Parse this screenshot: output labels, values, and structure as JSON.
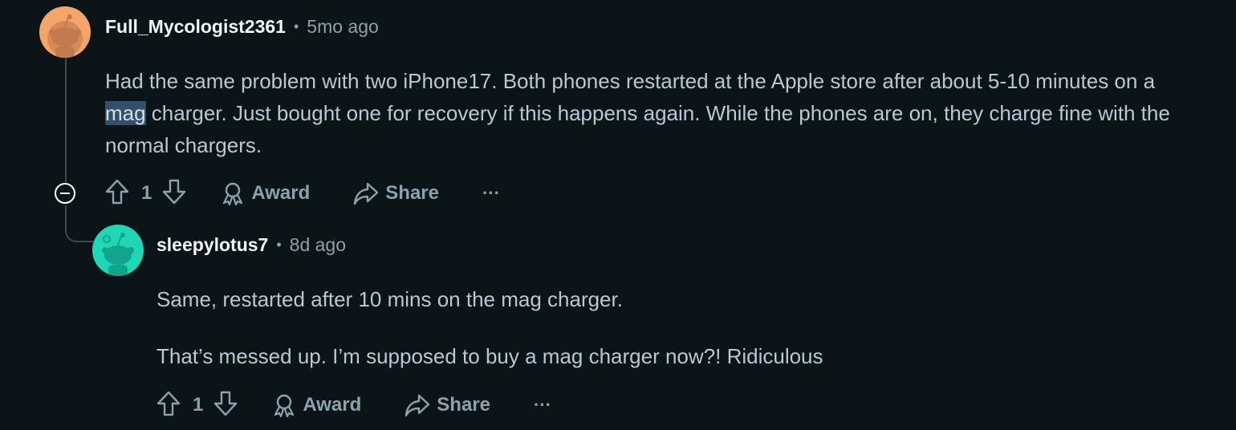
{
  "comments": [
    {
      "username": "Full_Mycologist2361",
      "separator": "•",
      "time": "5mo ago",
      "text_before": "Had the same problem with two iPhone17. Both phones restarted at the Apple store after about 5-10 minutes on a ",
      "text_highlight": "mag",
      "text_after": " charger. Just bought one for recovery if this happens again. While the phones are on, they charge fine with the normal chargers.",
      "votes": "1",
      "award_label": "Award",
      "share_label": "Share",
      "more_label": "···",
      "avatar_color": "#f6a568"
    },
    {
      "username": "sleepylotus7",
      "separator": "•",
      "time": "8d ago",
      "paragraph1": "Same, restarted after 10 mins on the mag charger.",
      "paragraph2": "That’s messed up. I’m supposed to buy a mag charger now?! Ridiculous",
      "votes": "1",
      "award_label": "Award",
      "share_label": "Share",
      "more_label": "···",
      "avatar_color": "#1fd6b5"
    }
  ],
  "icons": [
    "collapse-icon",
    "upvote-icon",
    "downvote-icon",
    "award-icon",
    "share-icon",
    "more-icon"
  ],
  "colors": {
    "background": "#0b1416",
    "text": "#b7cad4",
    "muted": "#8ba2ad",
    "highlight": "#34506c"
  }
}
